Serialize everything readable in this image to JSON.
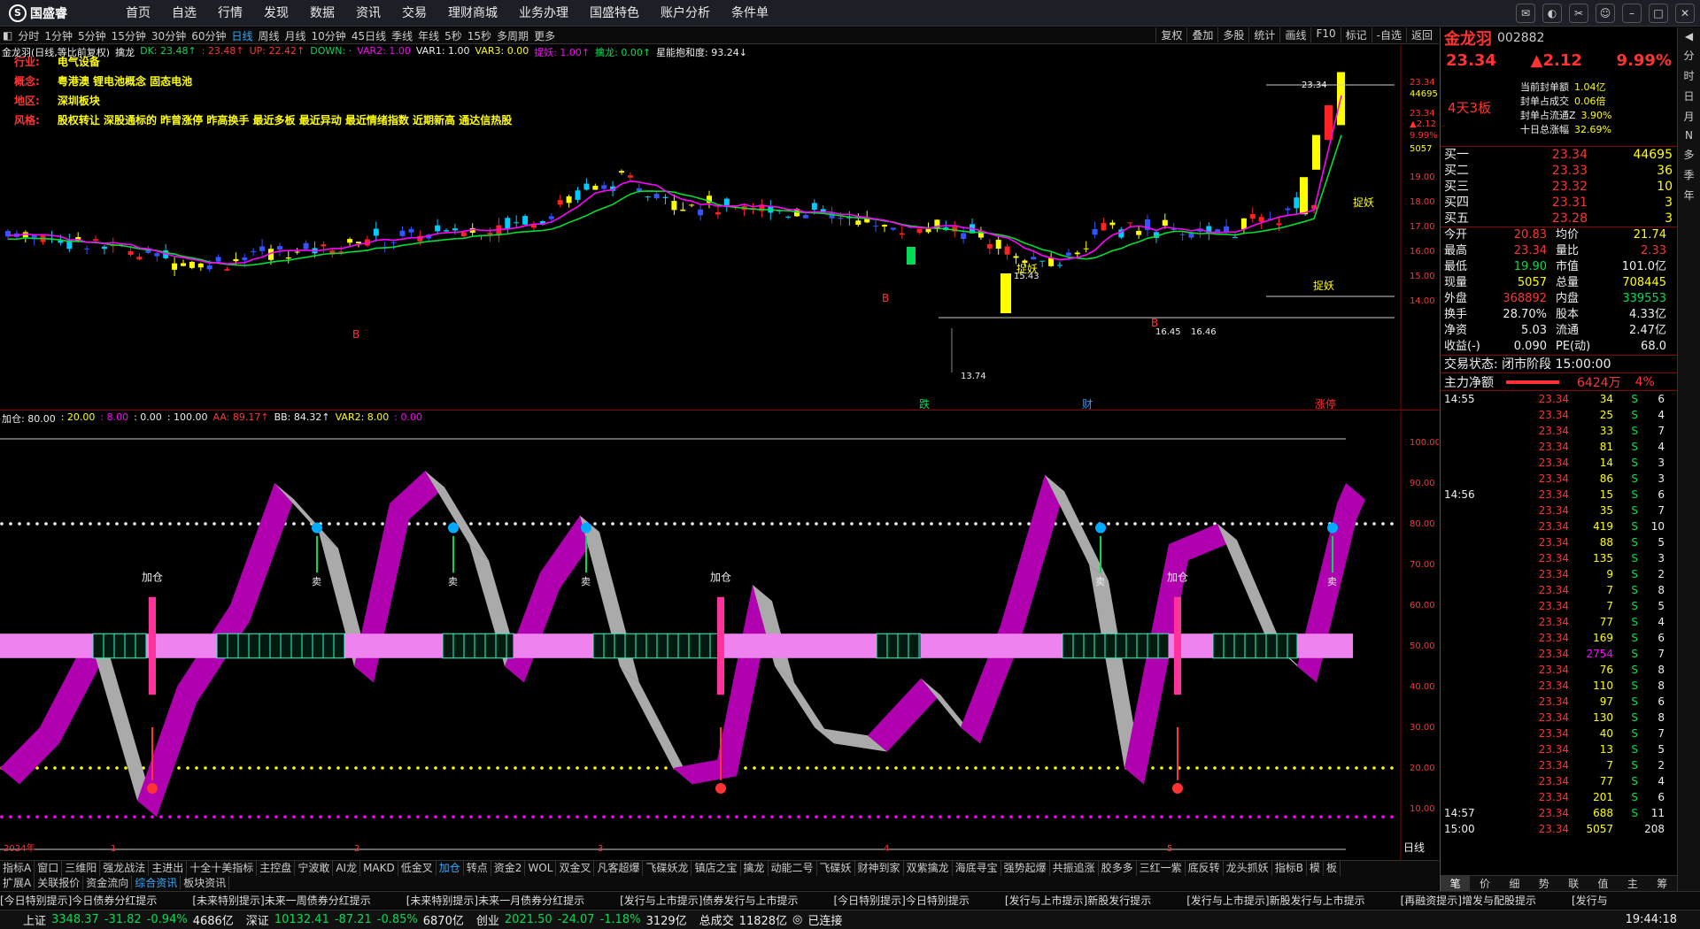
{
  "topbar": {
    "logo": "国盛睿",
    "menu": [
      "首页",
      "自选",
      "行情",
      "发现",
      "数据",
      "资讯",
      "交易",
      "理财商城",
      "业务办理",
      "国盛特色",
      "账户分析",
      "条件单"
    ]
  },
  "periods": [
    "分时",
    "1分钟",
    "5分钟",
    "15分钟",
    "30分钟",
    "60分钟",
    "日线",
    "周线",
    "月线",
    "10分钟",
    "45日线",
    "季线",
    "年线",
    "5秒",
    "15秒",
    "多周期",
    "更多"
  ],
  "period_active": "日线",
  "period_right": [
    "复权",
    "叠加",
    "多股",
    "统计",
    "画线",
    "F10",
    "标记",
    "-自选",
    "返回"
  ],
  "main": {
    "header": [
      {
        "t": "金龙羽(日线,等比前复权)",
        "c": "#eee"
      },
      {
        "t": "擒龙",
        "c": "#eee"
      },
      {
        "t": "DK: 23.48↑",
        "c": "#00dd55"
      },
      {
        "t": ": 23.48↑",
        "c": "#ff3333"
      },
      {
        "t": "UP: 22.42↑",
        "c": "#ff3333"
      },
      {
        "t": "DOWN: ·",
        "c": "#00dd55"
      },
      {
        "t": "VAR2: 1.00",
        "c": "#ff00ff"
      },
      {
        "t": "VAR1: 1.00",
        "c": "#eee"
      },
      {
        "t": "VAR3: 0.00",
        "c": "#ffff00"
      },
      {
        "t": "捉妖: 1.00↑",
        "c": "#ff00ff"
      },
      {
        "t": "擒龙: 0.00↑",
        "c": "#00dd55"
      },
      {
        "t": "星能抱和度: 93.24↓",
        "c": "#eee"
      }
    ],
    "info": [
      {
        "k": "行业:",
        "v": "电气设备"
      },
      {
        "k": "概念:",
        "v": "粤港澳 锂电池概念 固态电池"
      },
      {
        "k": "地区:",
        "v": "深圳板块"
      },
      {
        "k": "风格:",
        "v": "股权转让 深股通标的 昨曾涨停 昨高换手 最近多板 最近异动 最近情绪指数 近期新高 通达信热股"
      }
    ],
    "yaxis": [
      "23.34",
      "44695",
      "23.34",
      "▲2.12",
      "9.99%",
      "5057",
      "19.00",
      "18.00",
      "17.00",
      "16.00",
      "15.00",
      "14.00"
    ],
    "annotations": {
      "high": "23.34",
      "low": "13.74",
      "mid1": "16.45",
      "mid2": "16.46",
      "mid3": "15.43",
      "zhuoyao": "捉妖",
      "b": "B",
      "die": "跌",
      "cai": "财",
      "zhangting": "涨停"
    }
  },
  "sub": {
    "header": [
      {
        "t": "加仓: 80.00",
        "c": "#eee"
      },
      {
        "t": ": 20.00",
        "c": "#ffff00"
      },
      {
        "t": ": 8.00",
        "c": "#ff00ff"
      },
      {
        "t": ": 0.00",
        "c": "#eee"
      },
      {
        "t": ": 100.00",
        "c": "#eee"
      },
      {
        "t": "AA: 89.17↑",
        "c": "#ff3333"
      },
      {
        "t": "BB: 84.32↑",
        "c": "#eee"
      },
      {
        "t": "VAR2: 8.00",
        "c": "#ffff00"
      },
      {
        "t": ": 0.00",
        "c": "#ff00ff"
      }
    ],
    "yaxis": [
      "100.00",
      "90.00",
      "80.00",
      "70.00",
      "60.00",
      "50.00",
      "40.00",
      "30.00",
      "20.00",
      "10.00"
    ],
    "labels": {
      "add": "加仓",
      "sell": "卖"
    },
    "xaxis": [
      "2024年",
      "1",
      "2",
      "3",
      "4",
      "5"
    ],
    "xunit": "日线"
  },
  "indicators": [
    "指标A",
    "窗口",
    "三维阳",
    "强龙战法",
    "主进出",
    "十全十美指标",
    "主控盘",
    "宁波敢",
    "AI龙",
    "MAKD",
    "低金叉",
    "加仓",
    "转点",
    "资金2",
    "WOL",
    "双金叉",
    "凡客超爆",
    "飞碟妖龙",
    "镇店之宝",
    "擒龙",
    "动能二号",
    "飞碟妖",
    "财神到家",
    "双紫擒龙",
    "海底寻宝",
    "强势起爆",
    "共振追涨",
    "胶多多",
    "三红一紫",
    "底反转",
    "龙头抓妖",
    "指标B",
    "模",
    "板"
  ],
  "indicator_active": "加仓",
  "indicators2": [
    "扩展A",
    "关联报价",
    "资金流向",
    "综合资讯",
    "板块资讯"
  ],
  "indicator2_active": "综合资讯",
  "news": [
    "[今日特别提示]今日债券分红提示",
    "[未来特别提示]未来一周债券分红提示",
    "[未来特别提示]未来一月债券分红提示",
    "[发行与上市提示]债券发行与上市提示",
    "[今日特别提示]今日特别提示",
    "[发行与上市提示]新股发行提示",
    "[发行与上市提示]新股发行与上市提示",
    "[再融资提示]增发与配股提示",
    "[发行与"
  ],
  "status": {
    "sh_label": "上证",
    "sh_val": "3348.37",
    "sh_chg": "-31.82",
    "sh_pct": "-0.94%",
    "sh_amt": "4686亿",
    "sz_label": "深证",
    "sz_val": "10132.41",
    "sz_chg": "-87.21",
    "sz_pct": "-0.85%",
    "sz_amt": "6870亿",
    "cy_label": "创业",
    "cy_val": "2021.50",
    "cy_chg": "-24.07",
    "cy_pct": "-1.18%",
    "cy_amt": "3129亿",
    "total_label": "总成交",
    "total_amt": "11828亿",
    "conn": "已连接",
    "time": "19:44:18"
  },
  "panel": {
    "name": "金龙羽",
    "code": "002882",
    "price": "23.34",
    "chg": "▲2.12",
    "pct": "9.99%",
    "board": "4天3板",
    "seal": [
      {
        "k": "当前封单额",
        "v": "1.04亿"
      },
      {
        "k": "封单占成交",
        "v": "0.06倍"
      },
      {
        "k": "封单占流通Z",
        "v": "3.90%"
      },
      {
        "k": "十日总涨幅",
        "v": "32.69%"
      }
    ],
    "buys": [
      {
        "k": "买一",
        "p": "23.34",
        "v": "44695"
      },
      {
        "k": "买二",
        "p": "23.33",
        "v": "36"
      },
      {
        "k": "买三",
        "p": "23.32",
        "v": "10"
      },
      {
        "k": "买四",
        "p": "23.31",
        "v": "3"
      },
      {
        "k": "买五",
        "p": "23.28",
        "v": "3"
      }
    ],
    "quote": [
      {
        "a": "今开",
        "b": "20.83",
        "c": "均价",
        "d": "21.74"
      },
      {
        "a": "最高",
        "b": "23.34",
        "c": "量比",
        "d": "2.33"
      },
      {
        "a": "最低",
        "b": "19.90",
        "c": "市值",
        "d": "101.0亿"
      },
      {
        "a": "现量",
        "b": "5057",
        "c": "总量",
        "d": "708445"
      },
      {
        "a": "外盘",
        "b": "368892",
        "c": "内盘",
        "d": "339553"
      },
      {
        "a": "换手",
        "b": "28.70%",
        "c": "股本",
        "d": "4.33亿"
      },
      {
        "a": "净资",
        "b": "5.03",
        "c": "流通",
        "d": "2.47亿"
      },
      {
        "a": "收益(-)",
        "b": "0.090",
        "c": "PE(动)",
        "d": "68.0"
      }
    ],
    "status": "交易状态: 闭市阶段 15:00:00",
    "flow_label": "主力净额",
    "flow_val": "6424万",
    "flow_pct": "4%",
    "ticks": [
      {
        "t": "14:55",
        "p": "23.34",
        "v": "34",
        "s": "S",
        "n": "6"
      },
      {
        "t": "",
        "p": "23.34",
        "v": "25",
        "s": "S",
        "n": "4"
      },
      {
        "t": "",
        "p": "23.34",
        "v": "33",
        "s": "S",
        "n": "7"
      },
      {
        "t": "",
        "p": "23.34",
        "v": "81",
        "s": "S",
        "n": "4"
      },
      {
        "t": "",
        "p": "23.34",
        "v": "14",
        "s": "S",
        "n": "3"
      },
      {
        "t": "",
        "p": "23.34",
        "v": "86",
        "s": "S",
        "n": "3"
      },
      {
        "t": "14:56",
        "p": "23.34",
        "v": "15",
        "s": "S",
        "n": "6"
      },
      {
        "t": "",
        "p": "23.34",
        "v": "35",
        "s": "S",
        "n": "7"
      },
      {
        "t": "",
        "p": "23.34",
        "v": "419",
        "s": "S",
        "n": "10"
      },
      {
        "t": "",
        "p": "23.34",
        "v": "88",
        "s": "S",
        "n": "5"
      },
      {
        "t": "",
        "p": "23.34",
        "v": "135",
        "s": "S",
        "n": "3"
      },
      {
        "t": "",
        "p": "23.34",
        "v": "9",
        "s": "S",
        "n": "2"
      },
      {
        "t": "",
        "p": "23.34",
        "v": "7",
        "s": "S",
        "n": "8"
      },
      {
        "t": "",
        "p": "23.34",
        "v": "7",
        "s": "S",
        "n": "5"
      },
      {
        "t": "",
        "p": "23.34",
        "v": "77",
        "s": "S",
        "n": "4"
      },
      {
        "t": "",
        "p": "23.34",
        "v": "169",
        "s": "S",
        "n": "6"
      },
      {
        "t": "",
        "p": "23.34",
        "v": "2754",
        "s": "S",
        "n": "7"
      },
      {
        "t": "",
        "p": "23.34",
        "v": "76",
        "s": "S",
        "n": "8"
      },
      {
        "t": "",
        "p": "23.34",
        "v": "110",
        "s": "S",
        "n": "8"
      },
      {
        "t": "",
        "p": "23.34",
        "v": "97",
        "s": "S",
        "n": "6"
      },
      {
        "t": "",
        "p": "23.34",
        "v": "130",
        "s": "S",
        "n": "8"
      },
      {
        "t": "",
        "p": "23.34",
        "v": "40",
        "s": "S",
        "n": "7"
      },
      {
        "t": "",
        "p": "23.34",
        "v": "13",
        "s": "S",
        "n": "5"
      },
      {
        "t": "",
        "p": "23.34",
        "v": "7",
        "s": "S",
        "n": "2"
      },
      {
        "t": "",
        "p": "23.34",
        "v": "77",
        "s": "S",
        "n": "4"
      },
      {
        "t": "",
        "p": "23.34",
        "v": "201",
        "s": "S",
        "n": "6"
      },
      {
        "t": "14:57",
        "p": "23.34",
        "v": "688",
        "s": "S",
        "n": "11"
      },
      {
        "t": "15:00",
        "p": "23.34",
        "v": "5057",
        "s": "",
        "n": "208"
      }
    ],
    "tabs": [
      "笔",
      "价",
      "细",
      "势",
      "联",
      "值",
      "主",
      "筹"
    ]
  },
  "sidetools": [
    "◀",
    "分",
    "时",
    "日",
    "月",
    "N",
    "多",
    "季",
    "年"
  ],
  "colors": {
    "up": "#ff3333",
    "down": "#00dd55",
    "accent": "#3399ff",
    "magenta": "#ff00ff",
    "yellow": "#ffff00"
  }
}
